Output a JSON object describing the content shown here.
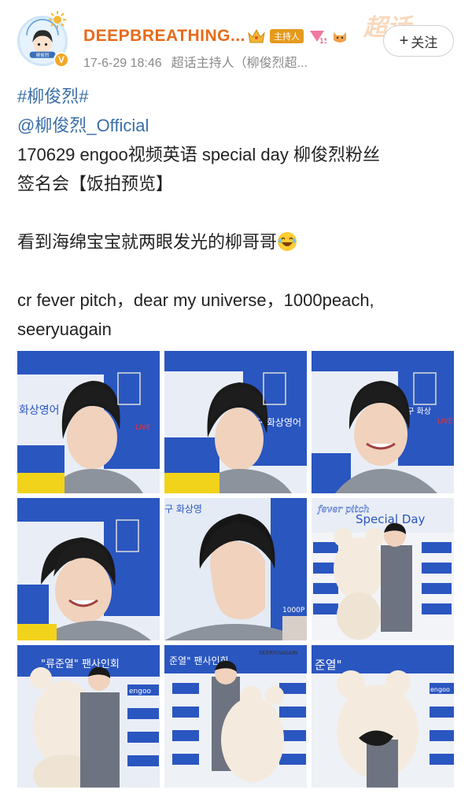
{
  "post": {
    "username": "DEEPBREATHING...",
    "host_badge": "主持人",
    "level": "15",
    "time": "17-6-29 18:46",
    "source": "超话主持人（柳俊烈超...",
    "follow_label": "关注",
    "super_topic_mark": "超话",
    "avatar_text": "柳俊烈",
    "avatar_badge": "V"
  },
  "content": {
    "hashtag": "#柳俊烈#",
    "mention": "@柳俊烈_Official",
    "line1": "170629  engoo视频英语 special day 柳俊烈粉丝",
    "line2": "签名会【饭拍预览】",
    "line3": "看到海绵宝宝就两眼发光的柳哥哥",
    "line4": "cr fever pitch，dear my universe，1000peach,",
    "line5": "seeryuagain"
  },
  "photos": [
    {
      "id": "photo-1",
      "sign_text": "화상영어",
      "sign_text2": "LIVE"
    },
    {
      "id": "photo-2",
      "sign_text": "엔구 화상영어",
      "sign_text2": ""
    },
    {
      "id": "photo-3",
      "sign_text": "엔구 화상",
      "sign_text2": "LIVE"
    },
    {
      "id": "photo-4",
      "sign_text": "",
      "sign_text2": ""
    },
    {
      "id": "photo-5",
      "sign_text": "구 화상영",
      "sign_text2": "1000P"
    },
    {
      "id": "photo-6",
      "sign_text": "Special Day",
      "sign_text2": "fever pitch"
    },
    {
      "id": "photo-7",
      "sign_text": "\"류준열\" 팬사인회",
      "sign_text2": "engoo"
    },
    {
      "id": "photo-8",
      "sign_text": "준열\" 팬사인회",
      "sign_text2": "SEERYUAGAIN"
    },
    {
      "id": "photo-9",
      "sign_text": "준열\"",
      "sign_text2": "engoo"
    }
  ],
  "colors": {
    "username": "#e86a1a",
    "link": "#3b6fa8",
    "backdrop_blue": "#2a56c0"
  }
}
